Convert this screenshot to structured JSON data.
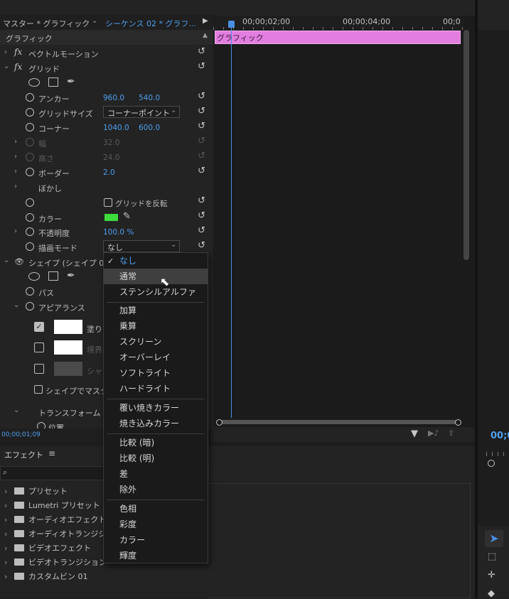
{
  "tabs": {
    "master": "マスター * グラフィック",
    "sequence": "シーケンス 02 * グラフ..."
  },
  "section_title": "グラフィック",
  "time_ruler": {
    "t1": "00;00;02;00",
    "t2": "00;00;04;00",
    "t3": "00;0"
  },
  "clip_label": "グラフィック",
  "effects": {
    "vector_motion": "ベクトルモーション",
    "grid": "グリッド",
    "anchor": {
      "label": "アンカー",
      "x": "960.0",
      "y": "540.0"
    },
    "grid_size": {
      "label": "グリッドサイズ",
      "value": "コーナーポイント"
    },
    "corner": {
      "label": "コーナー",
      "x": "1040.0",
      "y": "600.0"
    },
    "width": {
      "label": "幅",
      "value": "32.0"
    },
    "height": {
      "label": "高さ",
      "value": "24.0"
    },
    "border": {
      "label": "ボーダー",
      "value": "2.0"
    },
    "blur": {
      "label": "ぼかし"
    },
    "invert_grid": "グリッドを反転",
    "color": {
      "label": "カラー",
      "swatch": "#3ddc3d"
    },
    "opacity": {
      "label": "不透明度",
      "value": "100.0 %"
    },
    "blend_mode": {
      "label": "描画モード",
      "value": "なし"
    },
    "shape": "シェイプ (シェイプ 01",
    "path": "パス",
    "appearance": "アピアランス",
    "fill": "塗り",
    "stroke": "境界線",
    "shadow": "シャ",
    "mask_with_shape": "シェイプでマスク",
    "transform": "トランスフォーム",
    "position": "位置"
  },
  "timecode": "00;00;01;09",
  "right_timecode": "00;0",
  "dropdown": {
    "selected": "なし",
    "hovered": "通常",
    "items": [
      "なし",
      "通常",
      "ステンシルアルファ",
      "加算",
      "乗算",
      "スクリーン",
      "オーバーレイ",
      "ソフトライト",
      "ハードライト",
      "覆い焼きカラー",
      "焼き込みカラー",
      "比較 (暗)",
      "比較 (明)",
      "差",
      "除外",
      "色相",
      "彩度",
      "カラー",
      "輝度"
    ]
  },
  "effects_panel": {
    "title": "エフェクト",
    "folders": [
      "プリセット",
      "Lumetri プリセット",
      "オーディオエフェクト",
      "オーディオトランジション",
      "ビデオエフェクト",
      "ビデオトランジション",
      "カスタムビン 01"
    ]
  },
  "colors": {
    "accent": "#4d9ff0",
    "clip": "#e27ee0",
    "playhead": "#4a90e2"
  }
}
